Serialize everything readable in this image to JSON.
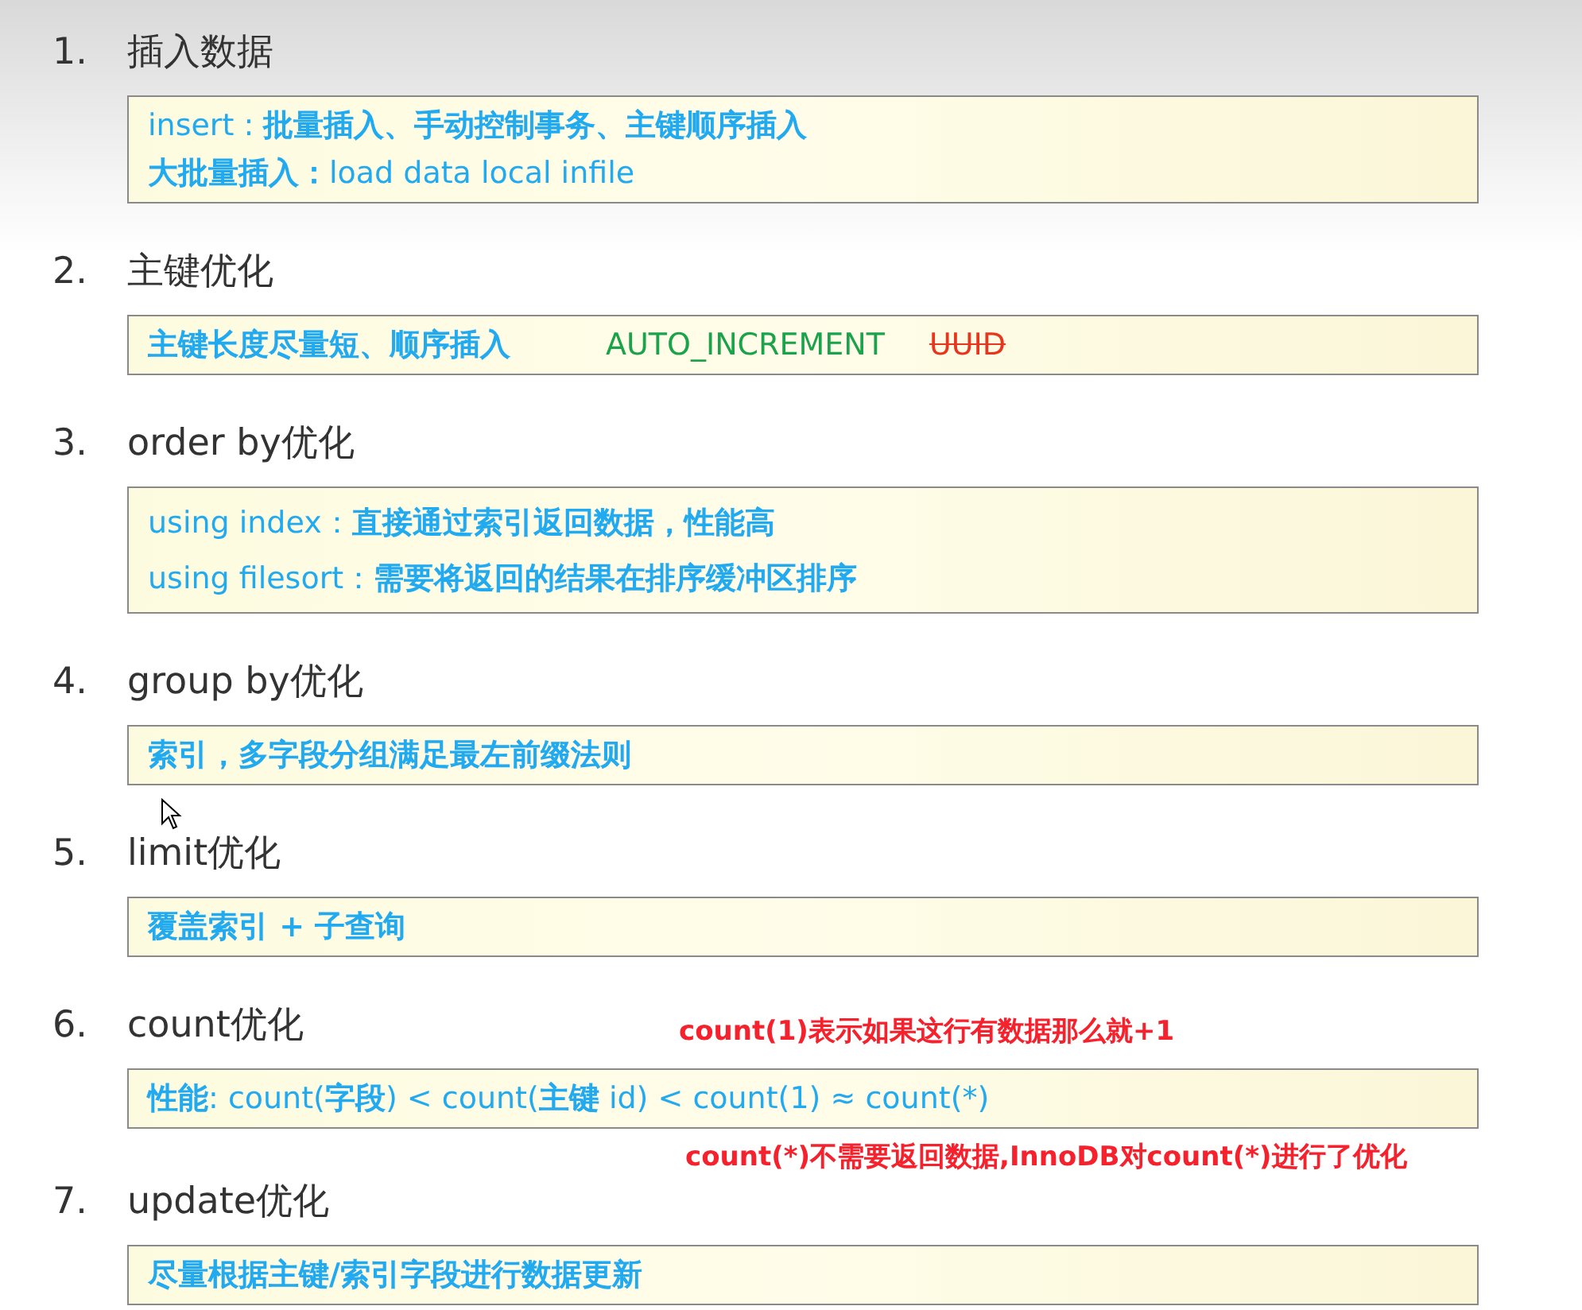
{
  "sections": [
    {
      "number": "1.",
      "title": "插入数据",
      "lines": [
        [
          {
            "kind": "note",
            "text": "insert : **批量插入、手动控制事务、主键顺序插入**"
          }
        ],
        [
          {
            "kind": "note",
            "text": "**大批量插入：**load  data  local  infile"
          }
        ]
      ]
    },
    {
      "number": "2.",
      "title": "主键优化",
      "lines": [
        [
          {
            "kind": "note",
            "text": "**主键长度尽量短、顺序插入**"
          },
          {
            "kind": "keyword",
            "text": "AUTO_INCREMENT"
          },
          {
            "kind": "struck",
            "text": "UUID"
          }
        ]
      ]
    },
    {
      "number": "3.",
      "title": "order by优化",
      "spaced": true,
      "lines": [
        [
          {
            "kind": "note",
            "text": "using index：**直接通过索引返回数据，性能高**"
          }
        ],
        [
          {
            "kind": "note",
            "text": "using filesort：**需要将返回的结果在排序缓冲区排序**"
          }
        ]
      ]
    },
    {
      "number": "4.",
      "title": "group by优化",
      "lines": [
        [
          {
            "kind": "note",
            "text": "**索引，多字段分组满足最左前缀法则**"
          }
        ]
      ]
    },
    {
      "number": "5.",
      "title": "limit优化",
      "lines": [
        [
          {
            "kind": "note",
            "text": "**覆盖索引 + 子查询**"
          }
        ]
      ]
    },
    {
      "number": "6.",
      "title": "count优化",
      "note_above": "count(1)表示如果这行有数据那么就+1",
      "note_below": "count(*)不需要返回数据,InnoDB对count(*)进行了优化",
      "lines": [
        [
          {
            "kind": "note",
            "text": "**性能**: count(**字段**) < count(**主键** id) < count(1) ≈ count(*)"
          }
        ]
      ]
    },
    {
      "number": "7.",
      "title": "update优化",
      "lines": [
        [
          {
            "kind": "note",
            "text": "**尽量根据主键/索引字段进行数据更新**"
          }
        ]
      ]
    }
  ]
}
